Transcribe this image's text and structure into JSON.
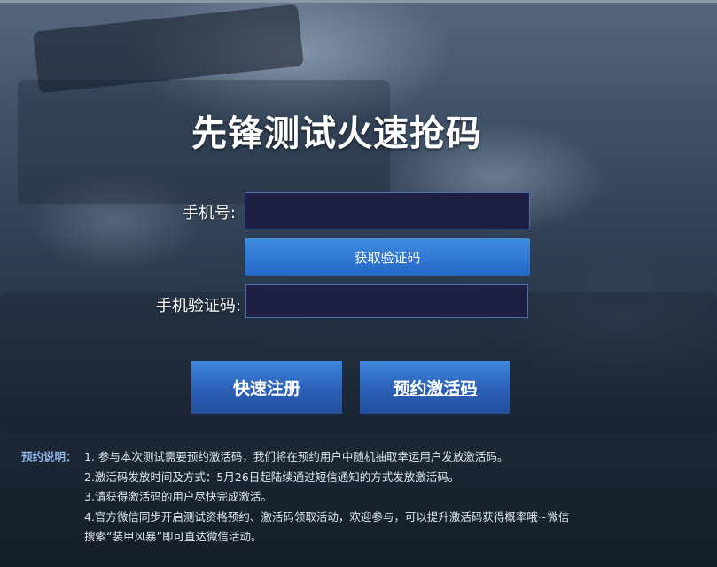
{
  "page": {
    "title": "先锋测试火速抢码"
  },
  "form": {
    "phone_label": "手机号:",
    "phone_value": "",
    "get_code_button": "获取验证码",
    "code_label": "手机验证码:",
    "code_value": ""
  },
  "actions": {
    "register_button": "快速注册",
    "reserve_button": "预约激活码"
  },
  "notes": {
    "heading": "预约说明：",
    "items": [
      "1. 参与本次测试需要预约激活码，我们将在预约用户中随机抽取幸运用户发放激活码。",
      "2.激活码发放时间及方式：5月26日起陆续通过短信通知的方式发放激活码。",
      "3.请获得激活码的用户尽快完成激活。",
      "4.官方微信同步开启测试资格预约、激活码领取活动，欢迎参与，可以提升激活码获得概率哦~微信",
      "搜索“装甲风暴”即可直达微信活动。"
    ]
  },
  "colors": {
    "title": "#ffffff",
    "input_bg": "#1e1f42",
    "input_border": "#4673b8",
    "button_blue": "#2d6cc4",
    "notes_heading": "#8fb4e6"
  }
}
